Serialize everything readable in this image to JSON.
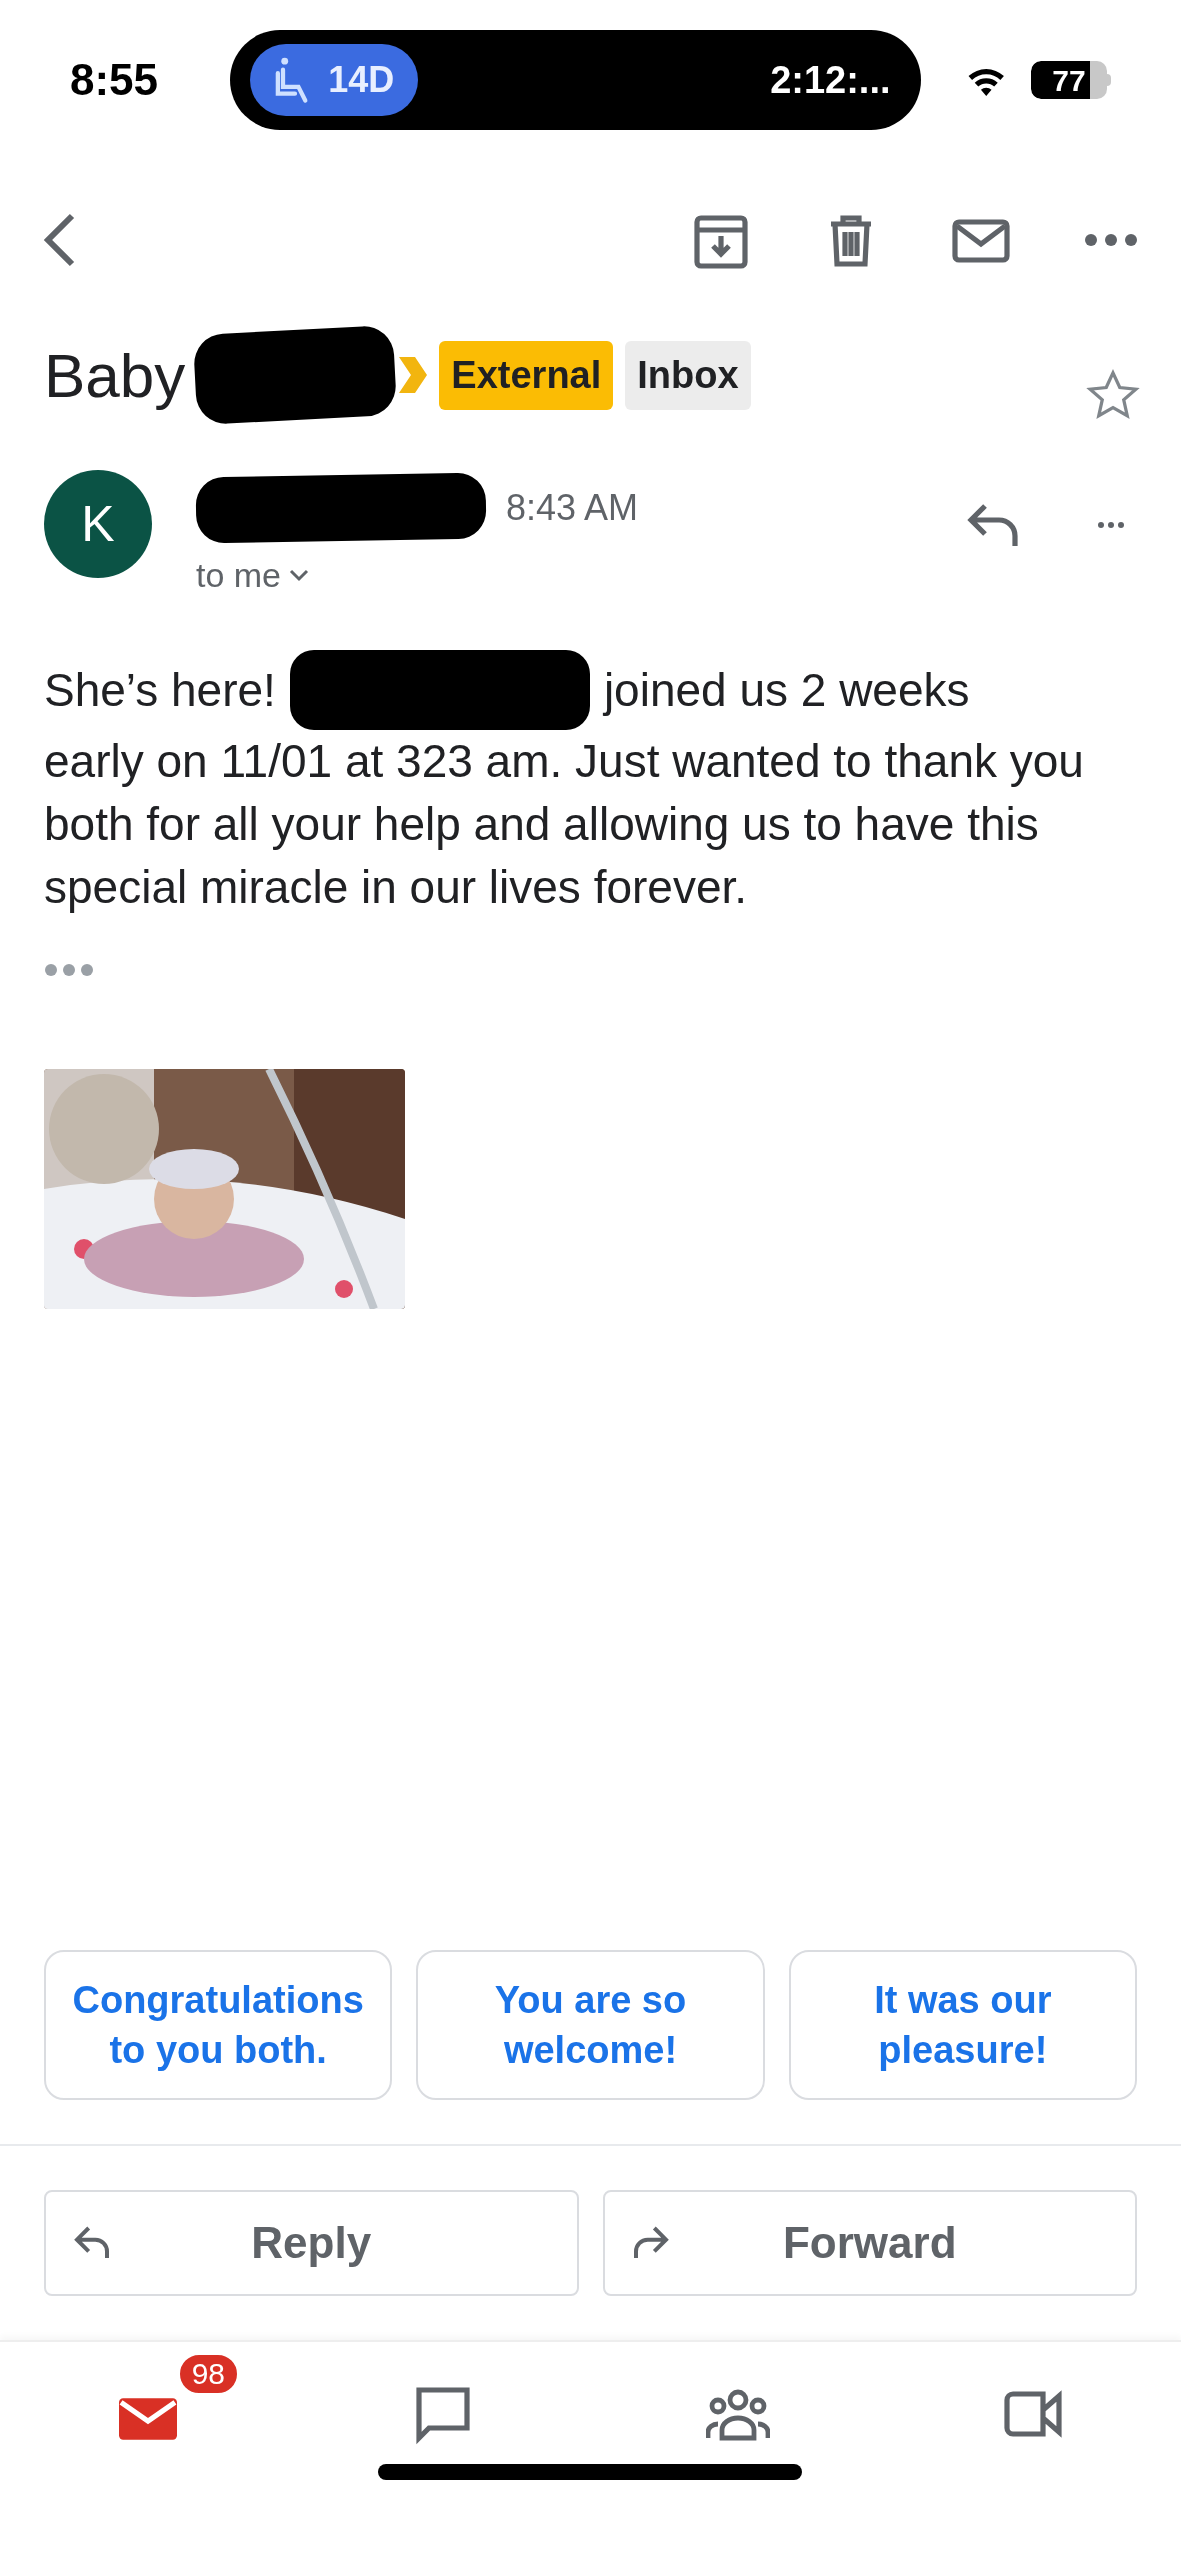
{
  "status_bar": {
    "time": "8:55",
    "activity_badge": "14D",
    "activity_timer": "2:12:...",
    "battery": "77"
  },
  "subject": {
    "text": "Baby",
    "redacted": true,
    "labels": [
      {
        "text": "External",
        "kind": "external"
      },
      {
        "text": "Inbox",
        "kind": "folder"
      }
    ],
    "starred": false
  },
  "message": {
    "avatar_letter": "K",
    "sender_redacted": true,
    "time": "8:43 AM",
    "recipient": "to me",
    "body_before": "She’s here!",
    "body_redacted": true,
    "body_after": "joined us 2 weeks",
    "body_rest": "early on 11/01 at 323 am. Just wanted to thank you both for all your help and allowing us to have this special miracle in our lives forever."
  },
  "smart_replies": [
    "Congratulations to you both.",
    "You are so welcome!",
    "It was our pleasure!"
  ],
  "actions": [
    {
      "label": "Reply",
      "kind": "reply"
    },
    {
      "label": "Forward",
      "kind": "forward"
    }
  ],
  "bottom_nav": [
    {
      "kind": "mail",
      "badge": "98",
      "selected": true
    },
    {
      "kind": "chat",
      "selected": false
    },
    {
      "kind": "spaces",
      "selected": false
    },
    {
      "kind": "meet",
      "selected": false
    }
  ]
}
